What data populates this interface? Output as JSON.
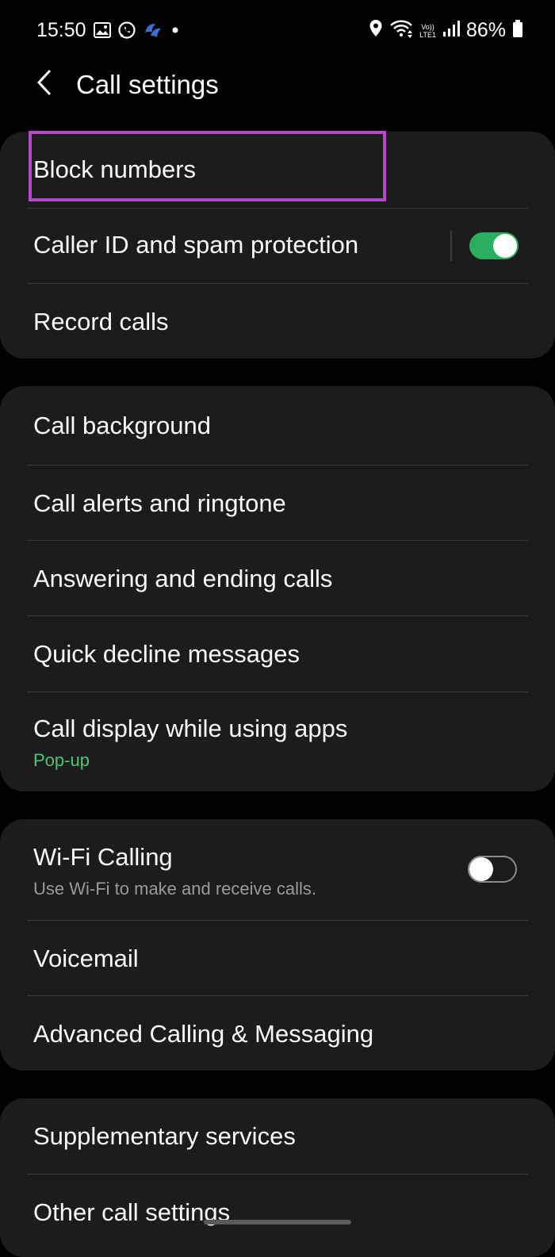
{
  "status_bar": {
    "time": "15:50",
    "left_icons": [
      "gallery-icon",
      "whatsapp-icon",
      "app-notification-icon",
      "dot-icon"
    ],
    "right_icons": [
      "location-icon",
      "wifi-icon",
      "volte-icon",
      "signal-icon",
      "battery-icon"
    ],
    "volte_label": "Vo))",
    "lte_label": "LTE1",
    "battery": "86%"
  },
  "header": {
    "title": "Call settings",
    "back_icon": "chevron-left-icon"
  },
  "groups": [
    {
      "items": [
        {
          "title": "Block numbers"
        },
        {
          "title": "Caller ID and spam protection",
          "toggle": true
        },
        {
          "title": "Record calls"
        }
      ]
    },
    {
      "items": [
        {
          "title": "Call background"
        },
        {
          "title": "Call alerts and ringtone"
        },
        {
          "title": "Answering and ending calls"
        },
        {
          "title": "Quick decline messages"
        },
        {
          "title": "Call display while using apps",
          "subtitle": "Pop-up"
        }
      ]
    },
    {
      "items": [
        {
          "title": "Wi-Fi Calling",
          "subtitle": "Use Wi-Fi to make and receive calls.",
          "toggle": false
        },
        {
          "title": "Voicemail"
        },
        {
          "title": "Advanced Calling & Messaging"
        }
      ]
    },
    {
      "items": [
        {
          "title": "Supplementary services"
        },
        {
          "title": "Other call settings"
        }
      ]
    }
  ],
  "colors": {
    "background": "#000000",
    "card": "#1c1c1c",
    "accent_green": "#2aae5f",
    "subtitle_green": "#4cc47a",
    "subtitle_gray": "#9a9a9a",
    "highlight": "#b548c6"
  }
}
